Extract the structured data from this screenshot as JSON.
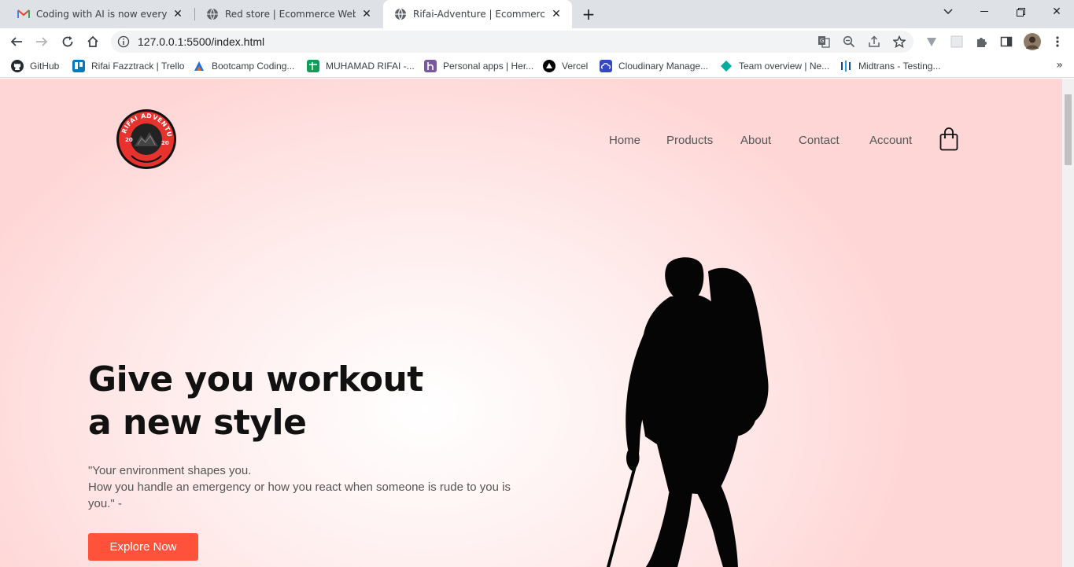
{
  "browser": {
    "tabs": [
      {
        "title": "Coding with AI is now everywhere",
        "favicon": "gmail-icon",
        "active": false
      },
      {
        "title": "Red store | Ecommerce Website D",
        "favicon": "globe-icon",
        "active": false
      },
      {
        "title": "Rifai-Adventure | Ecommerce We",
        "favicon": "globe-icon",
        "active": true
      }
    ],
    "url": "127.0.0.1:5500/index.html",
    "bookmarks": [
      {
        "label": "GitHub",
        "icon": "github-icon",
        "color": "#24292e"
      },
      {
        "label": "Rifai Fazztrack | Trello",
        "icon": "trello-icon",
        "color": "#0079bf"
      },
      {
        "label": "Bootcamp Coding...",
        "icon": "arrow-logo-icon",
        "color": "#1a73e8"
      },
      {
        "label": "MUHAMAD RIFAI -...",
        "icon": "sheets-icon",
        "color": "#0f9d58"
      },
      {
        "label": "Personal apps | Her...",
        "icon": "heroku-icon",
        "color": "#79589f"
      },
      {
        "label": "Vercel",
        "icon": "vercel-icon",
        "color": "#000000"
      },
      {
        "label": "Cloudinary Manage...",
        "icon": "cloudinary-icon",
        "color": "#3448c5"
      },
      {
        "label": "Team overview | Ne...",
        "icon": "netlify-icon",
        "color": "#00ad9f"
      },
      {
        "label": "Midtrans - Testing...",
        "icon": "midtrans-icon",
        "color": "#0e4c92"
      }
    ]
  },
  "site": {
    "logo_text": "RIFAI ADVENTURE",
    "logo_year_left": "20",
    "logo_year_right": "20",
    "nav": [
      "Home",
      "Products",
      "About",
      "Contact",
      "Account"
    ],
    "hero": {
      "headline_line1": "Give you workout",
      "headline_line2": "a new style",
      "quote_line1": "\"Your environment shapes you.",
      "quote_line2": "How you handle an emergency or how you react when someone is rude to you is you.\" -",
      "cta_label": "Explore Now"
    },
    "colors": {
      "accent": "#ff523b",
      "background": "#ffd6d6"
    }
  }
}
